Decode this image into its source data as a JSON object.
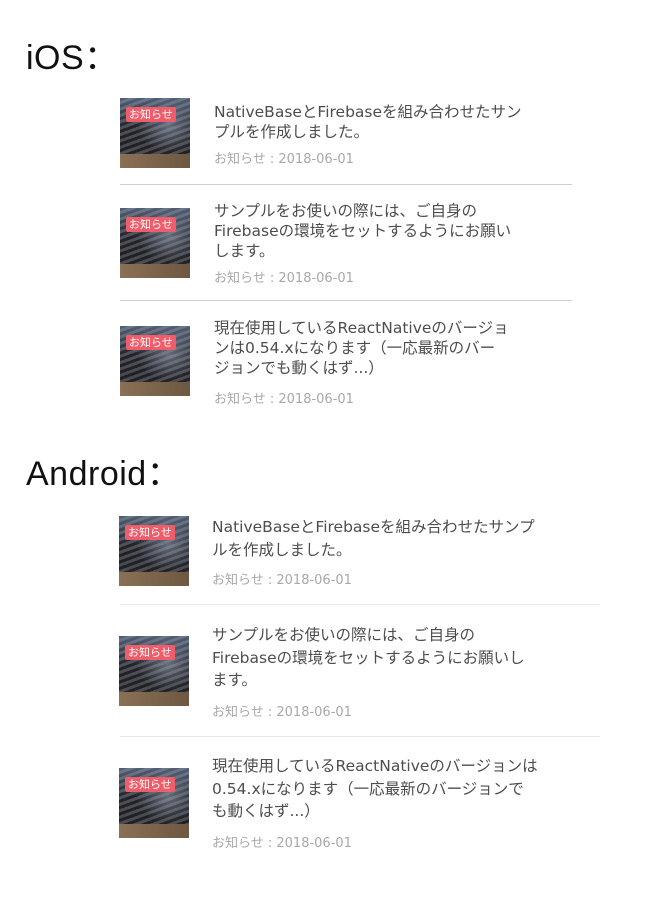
{
  "ios": {
    "heading": "iOS：",
    "items": [
      {
        "badge": "お知らせ",
        "title": "NativeBaseとFirebaseを組み合わせたサン\nプルを作成しました。",
        "meta": "お知らせ : 2018-06-01"
      },
      {
        "badge": "お知らせ",
        "title": "サンプルをお使いの際には、ご自身の\nFirebaseの環境をセットするようにお願い\nします。",
        "meta": "お知らせ : 2018-06-01"
      },
      {
        "badge": "お知らせ",
        "title": "現在使用しているReactNativeのバージョ\nンは0.54.xになります（一応最新のバー\nジョンでも動くはず...）",
        "meta": "お知らせ : 2018-06-01"
      }
    ]
  },
  "android": {
    "heading": "Android：",
    "items": [
      {
        "badge": "お知らせ",
        "title": "NativeBaseとFirebaseを組み合わせたサンプ\nルを作成しました。",
        "meta": "お知らせ : 2018-06-01"
      },
      {
        "badge": "お知らせ",
        "title": "サンプルをお使いの際には、ご自身の\nFirebaseの環境をセットするようにお願いし\nます。",
        "meta": "お知らせ : 2018-06-01"
      },
      {
        "badge": "お知らせ",
        "title": "現在使用しているReactNativeのバージョンは\n0.54.xになります（一応最新のバージョンで\nも動くはず...）",
        "meta": "お知らせ : 2018-06-01"
      }
    ]
  }
}
